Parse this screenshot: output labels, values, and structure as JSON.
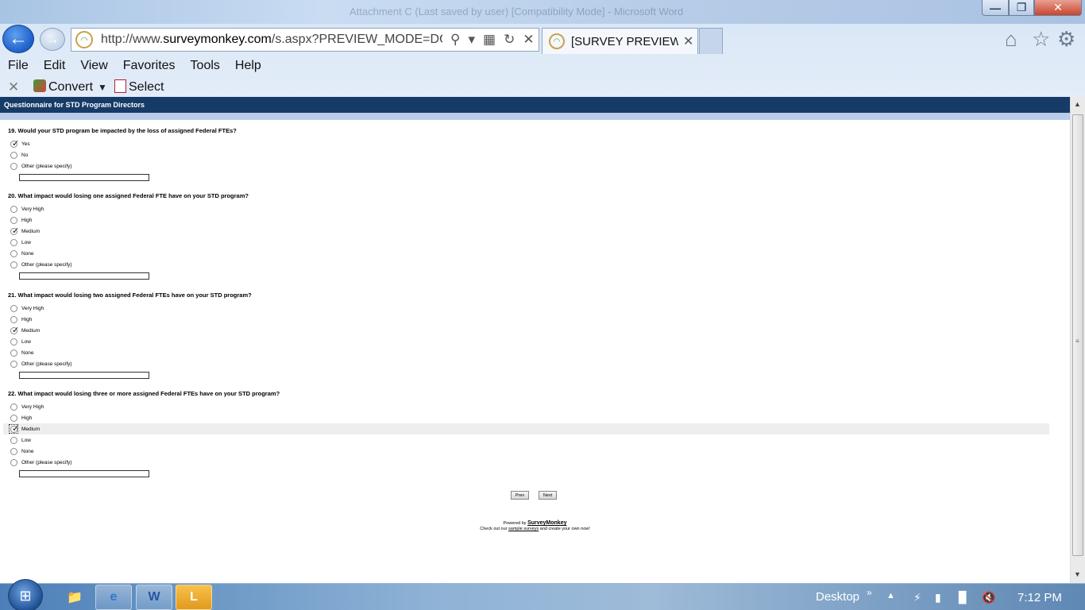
{
  "window": {
    "ghost_title": "Attachment C (Last saved by user) [Compatibility Mode] - Microsoft Word",
    "minimize": "—",
    "maximize": "❐",
    "close": "✕"
  },
  "browser": {
    "back_glyph": "←",
    "forward_glyph": "→",
    "url_prefix": "http://www.",
    "url_domain": "surveymonkey.com",
    "url_rest": "/s.aspx?PREVIEW_MODE=DO_NO",
    "tab_title": "[SURVEY PREVIEW ...",
    "tab_close": "✕",
    "icons": [
      "home-icon",
      "star-icon",
      "gear-icon"
    ],
    "menu": [
      "File",
      "Edit",
      "View",
      "Favorites",
      "Tools",
      "Help"
    ],
    "command_bar": {
      "convert_label": "Convert",
      "select_label": "Select"
    }
  },
  "survey": {
    "title": "Questionnaire for STD Program Directors",
    "questions": [
      {
        "text": "19. Would your STD program be impacted by the loss of assigned Federal FTEs?",
        "options": [
          "Yes",
          "No",
          "Other (please specify)"
        ],
        "selected": "Yes"
      },
      {
        "text": "20. What impact would losing one assigned Federal FTE have on your STD program?",
        "options": [
          "Very High",
          "High",
          "Medium",
          "Low",
          "None",
          "Other (please specify)"
        ],
        "selected": "Medium"
      },
      {
        "text": "21. What impact would losing two assigned Federal FTEs have on your STD program?",
        "options": [
          "Very High",
          "High",
          "Medium",
          "Low",
          "None",
          "Other (please specify)"
        ],
        "selected": "Medium"
      },
      {
        "text": "22. What impact would losing three or more assigned Federal FTEs have on your STD program?",
        "options": [
          "Very High",
          "High",
          "Medium",
          "Low",
          "None",
          "Other (please specify)"
        ],
        "selected": "Medium",
        "highlighted": "Medium"
      }
    ],
    "prev_label": "Prev",
    "next_label": "Next",
    "powered_by": "Powered by",
    "powered_brand": "SurveyMonkey",
    "checkout_pre": "Check out our",
    "checkout_link": "sample surveys",
    "checkout_post": "and create your own now!"
  },
  "taskbar": {
    "start_glyph": "⊞",
    "apps": [
      "explorer",
      "internet-explorer",
      "word",
      "lync"
    ],
    "desktop_label": "Desktop",
    "clock": "7:12 PM"
  },
  "colors": {
    "survey_header": "#163b67",
    "header_strip": "#b9cde8",
    "taskbar": "#8fb3d6"
  }
}
